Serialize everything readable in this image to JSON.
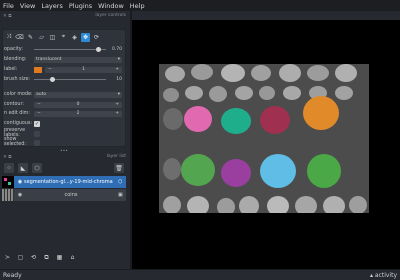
{
  "menu": [
    "File",
    "View",
    "Layers",
    "Plugins",
    "Window",
    "Help"
  ],
  "layer_controls": {
    "dock_title": "layer controls",
    "rows": [
      {
        "label": "opacity:",
        "type": "slider",
        "value": "0.70",
        "fraction": 0.7
      },
      {
        "label": "blending:",
        "type": "combo",
        "value": "translucent"
      },
      {
        "label": "label:",
        "type": "label",
        "value": "1"
      },
      {
        "label": "brush size:",
        "type": "slider",
        "value": "10",
        "fraction": 0.28
      },
      {
        "label": "color mode:",
        "type": "combo",
        "value": "auto"
      },
      {
        "label": "contour:",
        "type": "spin",
        "value": "0"
      },
      {
        "label": "n edit dim:",
        "type": "spin",
        "value": "2"
      },
      {
        "label": "contiguous:",
        "type": "check",
        "checked": true
      },
      {
        "label": "preserve labels:",
        "type": "check",
        "checked": false
      },
      {
        "label": "show selected:",
        "type": "check",
        "checked": false
      }
    ],
    "label_color": "#e07a1f"
  },
  "layer_list": {
    "dock_title": "layer list",
    "layers": [
      {
        "name": "segmentation-gl...y-19-mid-chroma",
        "selected": true
      },
      {
        "name": "coins",
        "selected": false
      }
    ]
  },
  "status": {
    "left": "Ready",
    "right": "activity"
  },
  "accent": "#2f8bd6"
}
